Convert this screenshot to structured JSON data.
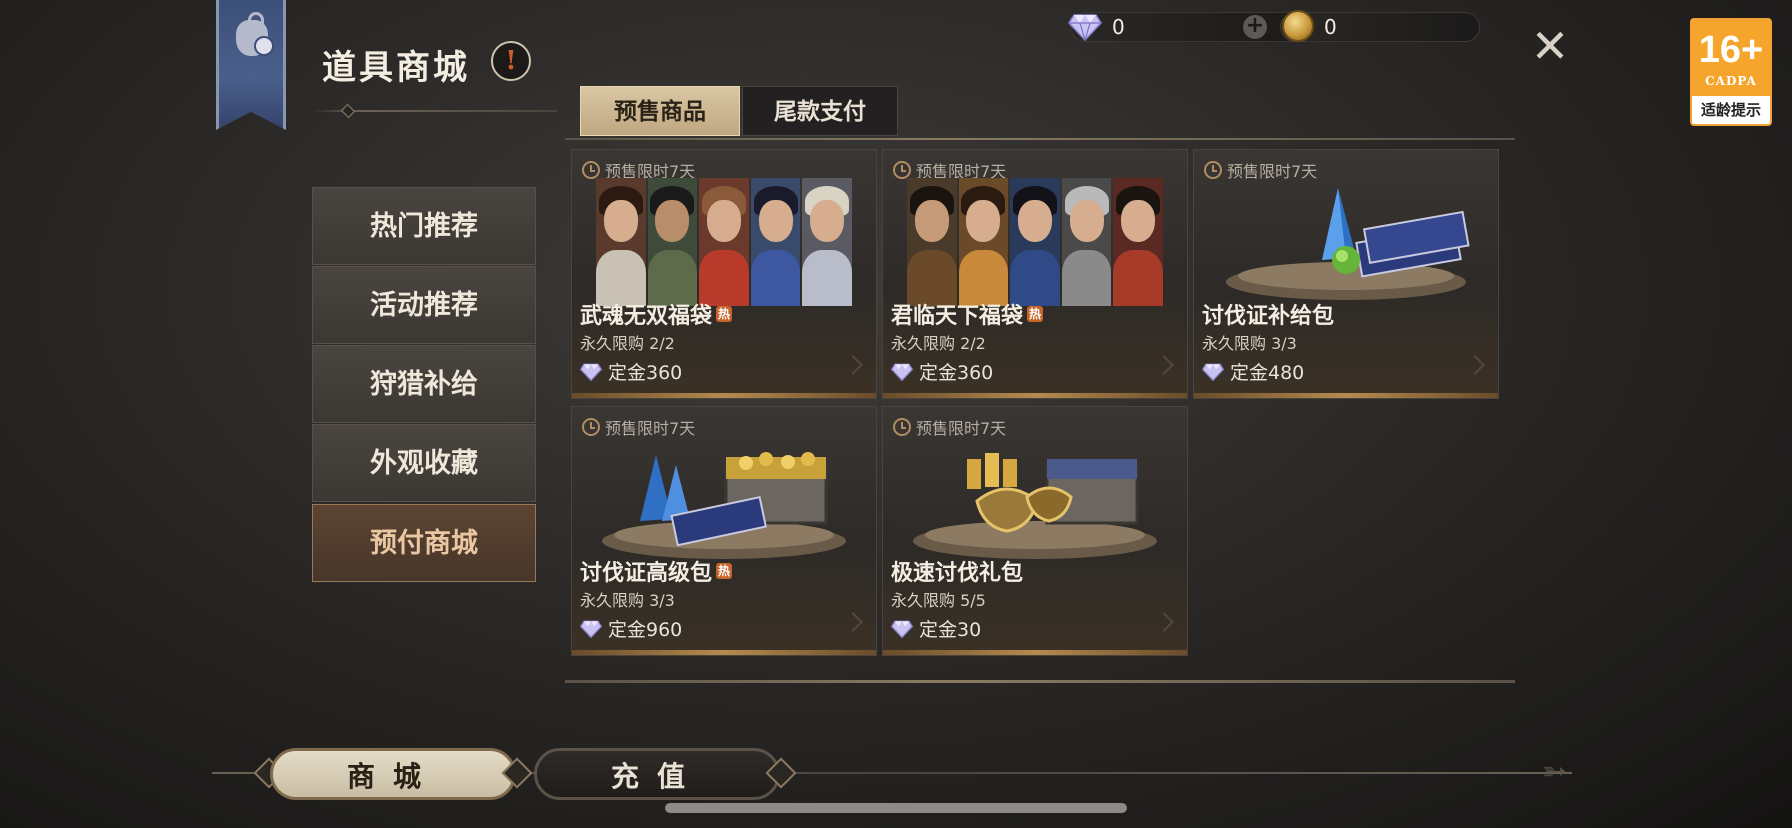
{
  "header": {
    "title": "道具商城",
    "info_symbol": "!"
  },
  "currency": {
    "gems": "0",
    "coins": "0",
    "plus_symbol": "+"
  },
  "close_symbol": "✕",
  "age_rating": {
    "age": "16+",
    "org": "CADPA",
    "tip": "适龄提示"
  },
  "tabs": [
    {
      "label": "预售商品",
      "active": true
    },
    {
      "label": "尾款支付",
      "active": false
    }
  ],
  "sidebar": {
    "items": [
      {
        "label": "热门推荐",
        "active": false
      },
      {
        "label": "活动推荐",
        "active": false
      },
      {
        "label": "狩猎补给",
        "active": false
      },
      {
        "label": "外观收藏",
        "active": false
      },
      {
        "label": "预付商城",
        "active": true
      }
    ]
  },
  "products": [
    {
      "presale": "预售限时7天",
      "name": "武魂无双福袋",
      "hot": "热",
      "limit": "永久限购 2/2",
      "price": "定金360",
      "art": "heroes-female"
    },
    {
      "presale": "预售限时7天",
      "name": "君临天下福袋",
      "hot": "热",
      "limit": "永久限购 2/2",
      "price": "定金360",
      "art": "heroes-male"
    },
    {
      "presale": "预售限时7天",
      "name": "讨伐证补给包",
      "hot": "",
      "limit": "永久限购 3/3",
      "price": "定金480",
      "art": "crystal-tickets"
    },
    {
      "presale": "预售限时7天",
      "name": "讨伐证高级包",
      "hot": "热",
      "limit": "永久限购 3/3",
      "price": "定金960",
      "art": "crystals-chest"
    },
    {
      "presale": "预售限时7天",
      "name": "极速讨伐礼包",
      "hot": "",
      "limit": "永久限购 5/5",
      "price": "定金30",
      "art": "gold-chest"
    }
  ],
  "bottom_nav": {
    "shop": "商城",
    "recharge": "充值"
  },
  "colors": {
    "accent_gold": "#b58a4e",
    "banner_blue": "#3c4f78",
    "hot_badge": "#c6642a",
    "age_orange": "#f6a52c"
  }
}
